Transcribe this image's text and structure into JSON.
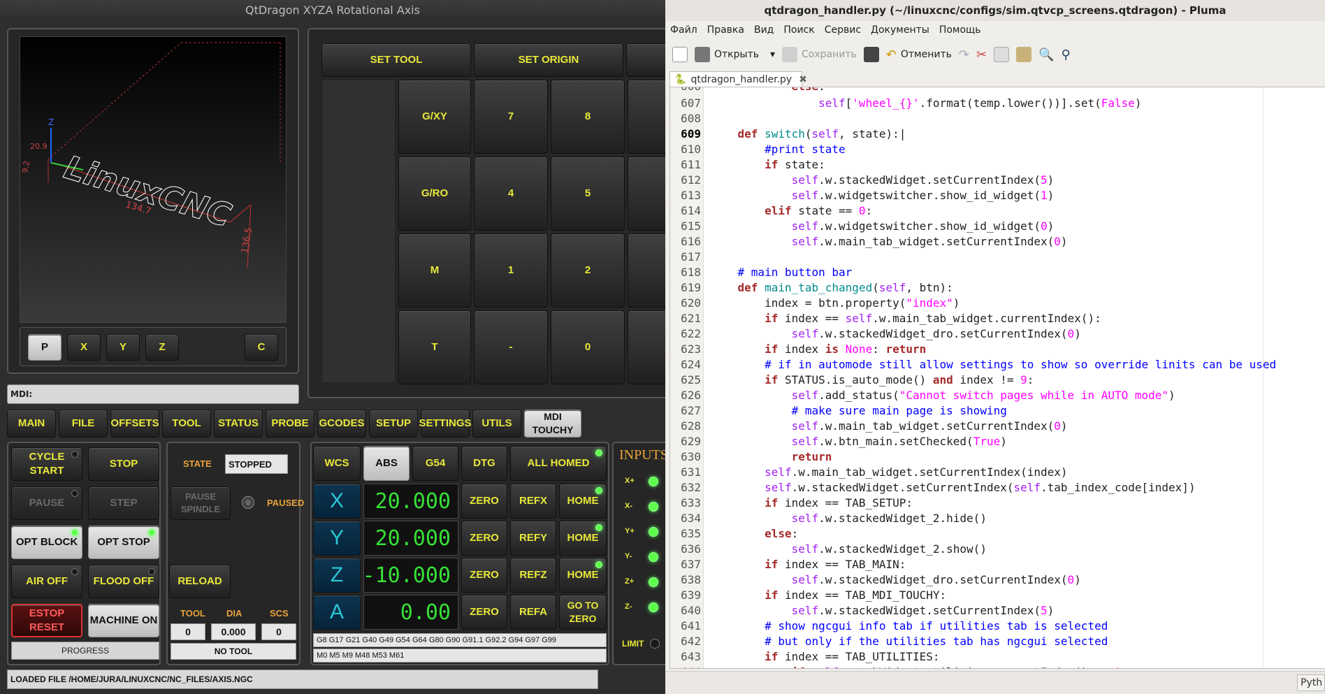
{
  "qt": {
    "title": "QtDragon XYZA Rotational Axis",
    "preview_buttons": [
      "P",
      "X",
      "Y",
      "Z",
      "C"
    ],
    "gcode_text": "LinuxCNC",
    "dims": [
      "20.9",
      "9.2",
      "134.7",
      "136.5"
    ],
    "mdi_label": "MDI:",
    "top_buttons": [
      "SET TOOL",
      "SET ORIGIN"
    ],
    "keypad": [
      [
        "G/XY",
        "7",
        "8"
      ],
      [
        "G/RO",
        "4",
        "5"
      ],
      [
        "M",
        "1",
        "2"
      ],
      [
        "T",
        "-",
        "0"
      ]
    ],
    "tabs": [
      "MAIN",
      "FILE",
      "OFFSETS",
      "TOOL",
      "STATUS",
      "PROBE",
      "GCODES",
      "SETUP",
      "SETTINGS",
      "UTILS",
      "MDI TOUCHY"
    ],
    "ctrl": {
      "cycle_start": "CYCLE START",
      "stop": "STOP",
      "pause": "PAUSE",
      "step": "STEP",
      "opt_block": "OPT BLOCK",
      "opt_stop": "OPT STOP",
      "air_off": "AIR OFF",
      "flood_off": "FLOOD OFF",
      "estop_reset": "ESTOP RESET",
      "machine_on": "MACHINE ON",
      "progress": "PROGRESS"
    },
    "state": {
      "label": "STATE",
      "value": "STOPPED",
      "pause_spindle": "PAUSE SPINDLE",
      "paused": "PAUSED",
      "reload": "RELOAD",
      "tool_h": "TOOL",
      "dia_h": "DIA",
      "scs_h": "SCS",
      "tool": "0",
      "dia": "0.000",
      "scs": "0",
      "no_tool": "NO TOOL"
    },
    "dro_top": {
      "wcs": "WCS",
      "abs": "ABS",
      "g54": "G54",
      "dtg": "DTG",
      "all_homed": "ALL HOMED"
    },
    "axes": [
      {
        "axis": "X",
        "value": "20.000",
        "zero": "ZERO",
        "ref": "REFX",
        "home": "HOME"
      },
      {
        "axis": "Y",
        "value": "20.000",
        "zero": "ZERO",
        "ref": "REFY",
        "home": "HOME"
      },
      {
        "axis": "Z",
        "value": "-10.000",
        "zero": "ZERO",
        "ref": "REFZ",
        "home": "HOME"
      },
      {
        "axis": "A",
        "value": "0.00",
        "zero": "ZERO",
        "ref": "REFA",
        "home": "GO TO ZERO"
      }
    ],
    "gcodes": "G8 G17 G21 G40 G49 G54 G64 G80 G90 G91.1 G92.2 G94 G97 G99",
    "mcodes": "M0 M5 M9 M48 M53 M61",
    "inputs_title": "INPUTS",
    "inputs": [
      "X+",
      "X-",
      "Y+",
      "Y-",
      "Z+",
      "Z-"
    ],
    "limit": "LIMIT",
    "loaded_file": "LOADED FILE /HOME/JURA/LINUXCNC/NC_FILES/AXIS.NGC"
  },
  "ed": {
    "title": "qtdragon_handler.py (~/linuxcnc/configs/sim.qtvcp_screens.qtdragon) - Pluma",
    "menu": [
      "Файл",
      "Правка",
      "Вид",
      "Поиск",
      "Сервис",
      "Документы",
      "Помощь"
    ],
    "open": "Открыть",
    "save": "Сохранить",
    "undo": "Отменить",
    "tab": "qtdragon_handler.py",
    "status": "Pyth"
  },
  "colors": {
    "dro": "#37e037",
    "accent": "#e8e83a",
    "led_on": "#5cff4a"
  }
}
